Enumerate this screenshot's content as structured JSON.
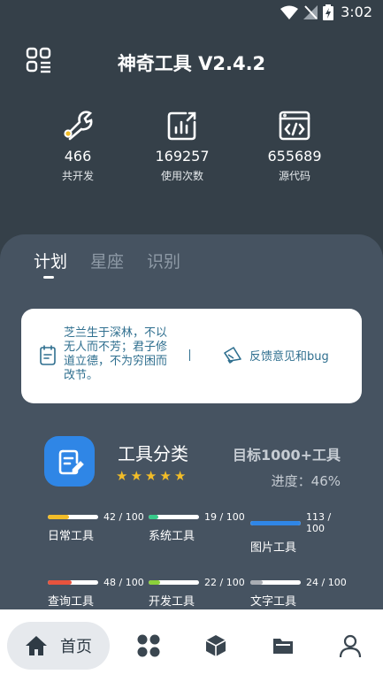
{
  "status_bar": {
    "time": "3:02"
  },
  "header": {
    "title": "神奇工具 V2.4.2"
  },
  "stats": [
    {
      "value": "466",
      "label": "共开发",
      "icon": "wrench-gear-icon"
    },
    {
      "value": "169257",
      "label": "使用次数",
      "icon": "bar-chart-icon"
    },
    {
      "value": "655689",
      "label": "源代码",
      "icon": "code-window-icon"
    }
  ],
  "tabs": [
    {
      "label": "计划",
      "active": true
    },
    {
      "label": "星座",
      "active": false
    },
    {
      "label": "识别",
      "active": false
    }
  ],
  "quote": {
    "text": "芝兰生于深林，不以无人而不芳；君子修道立德，不为穷困而改节。",
    "feedback_label": "反馈意见和bug"
  },
  "category": {
    "title": "工具分类",
    "rating": 5,
    "target": "目标1000+工具",
    "progress": "进度：46%"
  },
  "tools": [
    {
      "name": "日常工具",
      "count": "42 / 100",
      "fraction": 0.42,
      "color": "#f2bd28"
    },
    {
      "name": "系统工具",
      "count": "19 / 100",
      "fraction": 0.19,
      "color": "#37c98a"
    },
    {
      "name": "图片工具",
      "count": "113 / 100",
      "fraction": 1.0,
      "color": "#2f86e6"
    },
    {
      "name": "查询工具",
      "count": "48 / 100",
      "fraction": 0.48,
      "color": "#e8533d"
    },
    {
      "name": "开发工具",
      "count": "22 / 100",
      "fraction": 0.22,
      "color": "#8cd13a"
    },
    {
      "name": "文字工具",
      "count": "24 / 100",
      "fraction": 0.24,
      "color": "#a9adb3"
    }
  ],
  "bottom_nav": {
    "home_label": "首页",
    "items": [
      "home-icon",
      "apps-icon",
      "cube-icon",
      "folder-icon",
      "profile-icon"
    ]
  }
}
